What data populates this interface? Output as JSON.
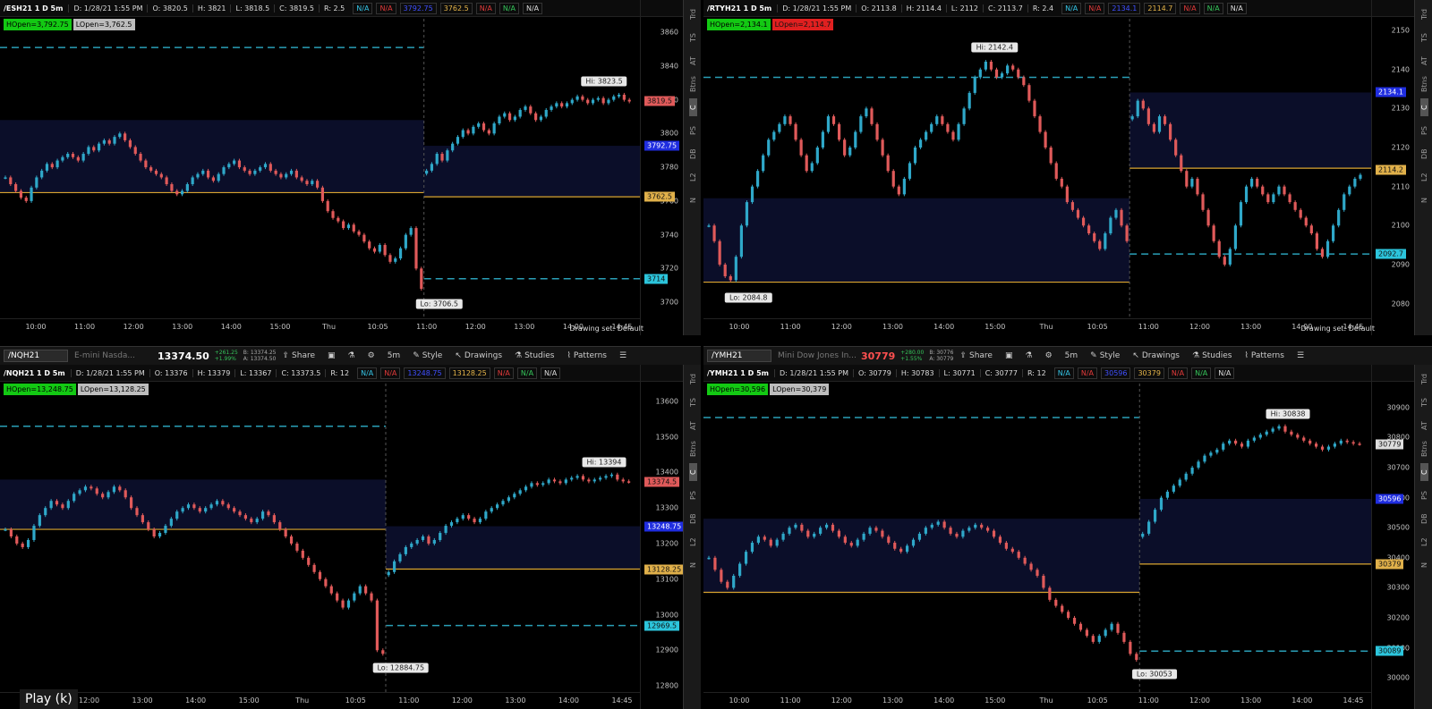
{
  "panels": [
    {
      "id": "es",
      "header": {
        "symbol": "/ESH21 1 D 5m",
        "fields": [
          "D: 1/28/21 1:55 PM",
          "O: 3820.5",
          "H: 3821",
          "L: 3818.5",
          "C: 3819.5",
          "R: 2.5"
        ],
        "tags": [
          {
            "text": "N/A",
            "color": "cyan"
          },
          {
            "text": "N/A",
            "color": "red"
          },
          {
            "text": "3792.75",
            "color": "blue"
          },
          {
            "text": "3762.5",
            "color": "yellow"
          },
          {
            "text": "N/A",
            "color": "red"
          },
          {
            "text": "N/A",
            "color": "green"
          },
          {
            "text": "N/A",
            "color": "white"
          }
        ]
      },
      "badges": [
        {
          "text": "HOpen=3,792.75",
          "color": "green"
        },
        {
          "text": "LOpen=3,762.5",
          "color": "gray"
        }
      ],
      "yticks": [
        "3860",
        "3840",
        "3820",
        "3800",
        "3780",
        "3760",
        "3740",
        "3720",
        "3700"
      ],
      "ymin": 3690,
      "ymax": 3868,
      "price_labels": [
        {
          "text": "3819.5",
          "value": 3819.5,
          "bg": "#e05a5a",
          "fg": "#111"
        },
        {
          "text": "3792.75",
          "value": 3792.75,
          "bg": "#1f2de0",
          "fg": "#fff"
        },
        {
          "text": "3762.5",
          "value": 3762.5,
          "bg": "#e0b04a",
          "fg": "#111"
        },
        {
          "text": "3714",
          "value": 3714,
          "bg": "#2cc5dc",
          "fg": "#111"
        }
      ],
      "xticks": [
        "10:00",
        "11:00",
        "12:00",
        "13:00",
        "14:00",
        "15:00",
        "Thu",
        "10:05",
        "11:00",
        "12:00",
        "13:00",
        "14:00",
        "14:45"
      ],
      "hi": {
        "text": "Hi: 3823.5",
        "value": 3823.5
      },
      "lo": {
        "text": "Lo: 3706.5",
        "value": 3706.5
      },
      "prev_high": 3851,
      "prev_low": 3714,
      "zone_top": 3808,
      "zone_mid": 3765,
      "cur_top": 3792.75,
      "cur_mid": 3762.5,
      "drawing_set": "Drawing set: Default",
      "sidebar": [
        "Trd",
        "TS",
        "AT",
        "Btns",
        "C",
        "PS",
        "DB",
        "L2",
        "N"
      ],
      "closes": [
        3774,
        3770,
        3766,
        3762,
        3760,
        3768,
        3774,
        3778,
        3782,
        3780,
        3784,
        3786,
        3788,
        3786,
        3784,
        3788,
        3792,
        3790,
        3794,
        3796,
        3794,
        3798,
        3800,
        3796,
        3792,
        3788,
        3784,
        3780,
        3778,
        3776,
        3774,
        3770,
        3766,
        3764,
        3766,
        3770,
        3774,
        3776,
        3778,
        3774,
        3772,
        3776,
        3780,
        3782,
        3784,
        3780,
        3778,
        3776,
        3778,
        3780,
        3782,
        3778,
        3776,
        3774,
        3776,
        3778,
        3774,
        3772,
        3770,
        3772,
        3768,
        3760,
        3754,
        3750,
        3748,
        3744,
        3746,
        3742,
        3740,
        3736,
        3732,
        3730,
        3734,
        3728,
        3724,
        3726,
        3732,
        3740,
        3744,
        3720,
        3708,
        3778,
        3782,
        3788,
        3784,
        3790,
        3794,
        3798,
        3802,
        3800,
        3804,
        3806,
        3802,
        3800,
        3806,
        3810,
        3812,
        3808,
        3810,
        3814,
        3816,
        3812,
        3808,
        3810,
        3814,
        3816,
        3818,
        3816,
        3818,
        3820,
        3822,
        3820,
        3818,
        3820,
        3821,
        3818,
        3820,
        3822,
        3823,
        3820,
        3819
      ]
    },
    {
      "id": "rty",
      "header": {
        "symbol": "/RTYH21 1 D 5m",
        "fields": [
          "D: 1/28/21 1:55 PM",
          "O: 2113.8",
          "H: 2114.4",
          "L: 2112",
          "C: 2113.7",
          "R: 2.4"
        ],
        "tags": [
          {
            "text": "N/A",
            "color": "cyan"
          },
          {
            "text": "N/A",
            "color": "red"
          },
          {
            "text": "2134.1",
            "color": "blue"
          },
          {
            "text": "2114.7",
            "color": "yellow"
          },
          {
            "text": "N/A",
            "color": "red"
          },
          {
            "text": "N/A",
            "color": "green"
          },
          {
            "text": "N/A",
            "color": "white"
          }
        ]
      },
      "badges": [
        {
          "text": "HOpen=2,134.1",
          "color": "green"
        },
        {
          "text": "LOpen=2,114.7",
          "color": "red"
        }
      ],
      "yticks": [
        "2150",
        "2140",
        "2130",
        "2120",
        "2110",
        "2100",
        "2090",
        "2080"
      ],
      "ymin": 2076,
      "ymax": 2153,
      "price_labels": [
        {
          "text": "2134.1",
          "value": 2134.1,
          "bg": "#1f2de0",
          "fg": "#fff"
        },
        {
          "text": "2114.2",
          "value": 2114.2,
          "bg": "#e0b04a",
          "fg": "#111"
        },
        {
          "text": "2092.7",
          "value": 2092.7,
          "bg": "#2cc5dc",
          "fg": "#111"
        }
      ],
      "xticks": [
        "10:00",
        "11:00",
        "12:00",
        "13:00",
        "14:00",
        "15:00",
        "Thu",
        "10:05",
        "11:00",
        "12:00",
        "13:00",
        "14:00",
        "14:45"
      ],
      "hi": {
        "text": "Hi: 2142.4",
        "value": 2142.4
      },
      "lo": {
        "text": "Lo: 2084.8",
        "value": 2084.8
      },
      "prev_high": 2138,
      "prev_low": 2092.7,
      "zone_top": 2107,
      "zone_mid": 2085.5,
      "cur_top": 2134.1,
      "cur_mid": 2114.7,
      "drawing_set": "Drawing set: Default",
      "sidebar": [
        "Trd",
        "TS",
        "AT",
        "Btns",
        "C",
        "PS",
        "DB",
        "L2",
        "N"
      ],
      "closes": [
        2100,
        2096,
        2090,
        2087,
        2086,
        2092,
        2100,
        2106,
        2110,
        2114,
        2118,
        2122,
        2124,
        2126,
        2128,
        2126,
        2122,
        2118,
        2114,
        2116,
        2120,
        2124,
        2128,
        2126,
        2122,
        2118,
        2120,
        2124,
        2128,
        2130,
        2126,
        2122,
        2118,
        2114,
        2110,
        2108,
        2112,
        2116,
        2120,
        2122,
        2124,
        2126,
        2128,
        2126,
        2124,
        2122,
        2126,
        2130,
        2134,
        2138,
        2140,
        2142,
        2140,
        2138,
        2139,
        2141,
        2140,
        2138,
        2136,
        2132,
        2128,
        2124,
        2120,
        2116,
        2112,
        2110,
        2106,
        2104,
        2102,
        2100,
        2098,
        2096,
        2094,
        2098,
        2102,
        2104,
        2100,
        2096,
        2128,
        2132,
        2130,
        2126,
        2124,
        2128,
        2126,
        2122,
        2118,
        2114,
        2110,
        2112,
        2108,
        2104,
        2100,
        2096,
        2092,
        2090,
        2094,
        2100,
        2106,
        2110,
        2112,
        2110,
        2108,
        2106,
        2108,
        2110,
        2108,
        2106,
        2104,
        2102,
        2100,
        2098,
        2094,
        2092,
        2096,
        2100,
        2104,
        2108,
        2110,
        2112,
        2113
      ]
    },
    {
      "id": "nq",
      "toolbar": {
        "symbol": "/NQH21",
        "desc": "E-mini Nasda...",
        "last": "13374.50",
        "last_red": false,
        "chg1": "+261.25",
        "chg2": "+1.99%",
        "bid": "B: 13374.25",
        "ask": "A: 13374.50",
        "share": "Share",
        "agg": "5m",
        "style": "Style",
        "drawings": "Drawings",
        "studies": "Studies",
        "patterns": "Patterns"
      },
      "header": {
        "symbol": "/NQH21 1 D 5m",
        "fields": [
          "D: 1/28/21 1:55 PM",
          "O: 13376",
          "H: 13379",
          "L: 13367",
          "C: 13373.5",
          "R: 12"
        ],
        "tags": [
          {
            "text": "N/A",
            "color": "cyan"
          },
          {
            "text": "N/A",
            "color": "red"
          },
          {
            "text": "13248.75",
            "color": "blue"
          },
          {
            "text": "13128.25",
            "color": "yellow"
          },
          {
            "text": "N/A",
            "color": "red"
          },
          {
            "text": "N/A",
            "color": "green"
          },
          {
            "text": "N/A",
            "color": "white"
          }
        ]
      },
      "badges": [
        {
          "text": "HOpen=13,248.75",
          "color": "green"
        },
        {
          "text": "LOpen=13,128.25",
          "color": "gray"
        }
      ],
      "yticks": [
        "13600",
        "13500",
        "13400",
        "13300",
        "13200",
        "13100",
        "13000",
        "12900",
        "12800"
      ],
      "ymin": 12780,
      "ymax": 13650,
      "price_labels": [
        {
          "text": "13374.5",
          "value": 13374.5,
          "bg": "#e05a5a",
          "fg": "#111"
        },
        {
          "text": "13248.75",
          "value": 13248.75,
          "bg": "#1f2de0",
          "fg": "#fff"
        },
        {
          "text": "13128.25",
          "value": 13128.25,
          "bg": "#e0b04a",
          "fg": "#111"
        },
        {
          "text": "12969.5",
          "value": 12969.5,
          "bg": "#2cc5dc",
          "fg": "#111"
        }
      ],
      "xticks": [
        "11:00",
        "12:00",
        "13:00",
        "14:00",
        "15:00",
        "Thu",
        "10:05",
        "11:00",
        "12:00",
        "13:00",
        "14:00",
        "14:45"
      ],
      "hi": {
        "text": "Hi: 13394",
        "value": 13394
      },
      "lo": {
        "text": "Lo: 12884.75",
        "value": 12884.75
      },
      "prev_high": 13530,
      "prev_low": 12969.5,
      "zone_top": 13380,
      "zone_mid": 13240,
      "cur_top": 13248.75,
      "cur_mid": 13128.25,
      "sidebar": [
        "Trd",
        "TS",
        "AT",
        "Btns",
        "C",
        "PS",
        "DB",
        "L2",
        "N"
      ],
      "closes": [
        13240,
        13220,
        13200,
        13190,
        13210,
        13250,
        13280,
        13300,
        13320,
        13310,
        13300,
        13320,
        13340,
        13350,
        13360,
        13355,
        13340,
        13330,
        13345,
        13360,
        13350,
        13330,
        13300,
        13280,
        13260,
        13240,
        13220,
        13230,
        13250,
        13270,
        13290,
        13300,
        13310,
        13300,
        13290,
        13300,
        13310,
        13320,
        13310,
        13300,
        13290,
        13280,
        13270,
        13260,
        13270,
        13290,
        13280,
        13260,
        13240,
        13220,
        13200,
        13180,
        13160,
        13140,
        13120,
        13100,
        13080,
        13060,
        13040,
        13020,
        13040,
        13060,
        13080,
        13060,
        13040,
        12900,
        12890,
        13120,
        13150,
        13170,
        13190,
        13200,
        13210,
        13220,
        13200,
        13210,
        13230,
        13250,
        13260,
        13270,
        13280,
        13270,
        13260,
        13270,
        13290,
        13300,
        13310,
        13320,
        13330,
        13340,
        13350,
        13360,
        13370,
        13365,
        13370,
        13380,
        13375,
        13370,
        13380,
        13385,
        13390,
        13380,
        13375,
        13380,
        13385,
        13390,
        13394,
        13380,
        13375,
        13374
      ]
    },
    {
      "id": "ym",
      "toolbar": {
        "symbol": "/YMH21",
        "desc": "Mini Dow Jones In...",
        "last": "30779",
        "last_red": true,
        "chg1": "+280.00",
        "chg2": "+1.55%",
        "bid": "B: 30776",
        "ask": "A: 30779",
        "share": "Share",
        "agg": "5m",
        "style": "Style",
        "drawings": "Drawings",
        "studies": "Studies",
        "patterns": "Patterns"
      },
      "header": {
        "symbol": "/YMH21 1 D 5m",
        "fields": [
          "D: 1/28/21 1:55 PM",
          "O: 30779",
          "H: 30783",
          "L: 30771",
          "C: 30777",
          "R: 12"
        ],
        "tags": [
          {
            "text": "N/A",
            "color": "cyan"
          },
          {
            "text": "N/A",
            "color": "red"
          },
          {
            "text": "30596",
            "color": "blue"
          },
          {
            "text": "30379",
            "color": "yellow"
          },
          {
            "text": "N/A",
            "color": "red"
          },
          {
            "text": "N/A",
            "color": "green"
          },
          {
            "text": "N/A",
            "color": "white"
          }
        ]
      },
      "badges": [
        {
          "text": "HOpen=30,596",
          "color": "green"
        },
        {
          "text": "LOpen=30,379",
          "color": "gray"
        }
      ],
      "yticks": [
        "30900",
        "30800",
        "30700",
        "30600",
        "30500",
        "30400",
        "30300",
        "30200",
        "30100",
        "30000"
      ],
      "ymin": 29950,
      "ymax": 30980,
      "price_labels": [
        {
          "text": "30779",
          "value": 30779,
          "bg": "#dddddd",
          "fg": "#111"
        },
        {
          "text": "30596",
          "value": 30596,
          "bg": "#1f2de0",
          "fg": "#fff"
        },
        {
          "text": "30379",
          "value": 30379,
          "bg": "#e0b04a",
          "fg": "#111"
        },
        {
          "text": "30089",
          "value": 30089,
          "bg": "#2cc5dc",
          "fg": "#111"
        }
      ],
      "xticks": [
        "10:00",
        "11:00",
        "12:00",
        "13:00",
        "14:00",
        "15:00",
        "Thu",
        "10:05",
        "11:00",
        "12:00",
        "13:00",
        "14:00",
        "14:45"
      ],
      "hi": {
        "text": "Hi: 30838",
        "value": 30838
      },
      "lo": {
        "text": "Lo: 30053",
        "value": 30053
      },
      "prev_high": 30867,
      "prev_low": 30089,
      "zone_top": 30530,
      "zone_mid": 30285,
      "cur_top": 30596,
      "cur_mid": 30379,
      "sidebar": [
        "Trd",
        "TS",
        "AT",
        "Btns",
        "C",
        "PS",
        "DB",
        "L2",
        "N"
      ],
      "closes": [
        30400,
        30360,
        30320,
        30300,
        30340,
        30380,
        30420,
        30450,
        30470,
        30460,
        30440,
        30460,
        30480,
        30500,
        30510,
        30490,
        30470,
        30480,
        30500,
        30510,
        30490,
        30470,
        30450,
        30440,
        30460,
        30480,
        30500,
        30490,
        30470,
        30450,
        30430,
        30420,
        30440,
        30460,
        30480,
        30500,
        30510,
        30520,
        30500,
        30480,
        30470,
        30490,
        30500,
        30510,
        30500,
        30490,
        30470,
        30450,
        30430,
        30420,
        30400,
        30380,
        30360,
        30340,
        30300,
        30260,
        30240,
        30220,
        30200,
        30180,
        30160,
        30140,
        30120,
        30140,
        30160,
        30180,
        30150,
        30120,
        30080,
        30060,
        30480,
        30520,
        30560,
        30600,
        30620,
        30640,
        30660,
        30680,
        30700,
        30720,
        30740,
        30750,
        30760,
        30780,
        30790,
        30780,
        30770,
        30790,
        30800,
        30810,
        30820,
        30830,
        30838,
        30820,
        30810,
        30800,
        30790,
        30780,
        30770,
        30760,
        30770,
        30780,
        30790,
        30785,
        30780,
        30779
      ]
    }
  ],
  "play_label": "Play (k)",
  "colors": {
    "up": "#2fa8c9",
    "down": "#e05a5a",
    "zone": "#0c0f2e",
    "yellow": "#d9a530",
    "cyan": "#2a9fb7"
  }
}
